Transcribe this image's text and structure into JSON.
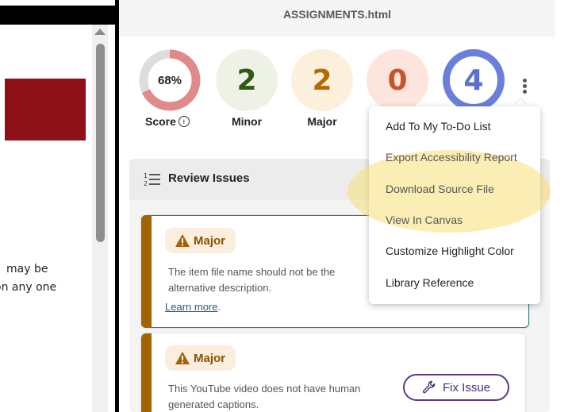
{
  "left_page": {
    "fragments": [
      "may be",
      "on any one"
    ]
  },
  "panel": {
    "title": "ASSIGNMENTS.html",
    "score": {
      "value": "68%",
      "percent": 68,
      "label": "Score",
      "info_icon": "info-circle-icon",
      "ring_color": "#e08a8a",
      "track_color": "#dddddd"
    },
    "counters": [
      {
        "value": "2",
        "label": "Minor",
        "bg": "#eef2e6",
        "color": "#2e5a12"
      },
      {
        "value": "2",
        "label": "Major",
        "bg": "#fcefdc",
        "color": "#b36b00"
      },
      {
        "value": "0",
        "label": "",
        "bg": "#fde5dd",
        "color": "#c8542a"
      },
      {
        "value": "4",
        "label": "",
        "bg": "#ffffff",
        "color": "#5b6fd0"
      }
    ],
    "review": {
      "title": "Review Issues",
      "icon": "numbered-list-icon",
      "issues": [
        {
          "badge": "Major",
          "icon": "warning-icon",
          "line1": "The item file name should not be the",
          "line2": "alternative description.",
          "learn_more": "Learn more",
          "period": "."
        },
        {
          "badge": "Major",
          "icon": "warning-icon",
          "line1": "This YouTube video does not have human",
          "line2": "generated captions.",
          "fix_label": "Fix Issue",
          "fix_icon": "wrench-icon"
        }
      ]
    },
    "menu": {
      "items": [
        "Add To My To-Do List",
        "Export Accessibility Report",
        "Download Source File",
        "View In Canvas",
        "Customize Highlight Color",
        "Library Reference"
      ],
      "highlight_color": "#f5e078"
    }
  }
}
